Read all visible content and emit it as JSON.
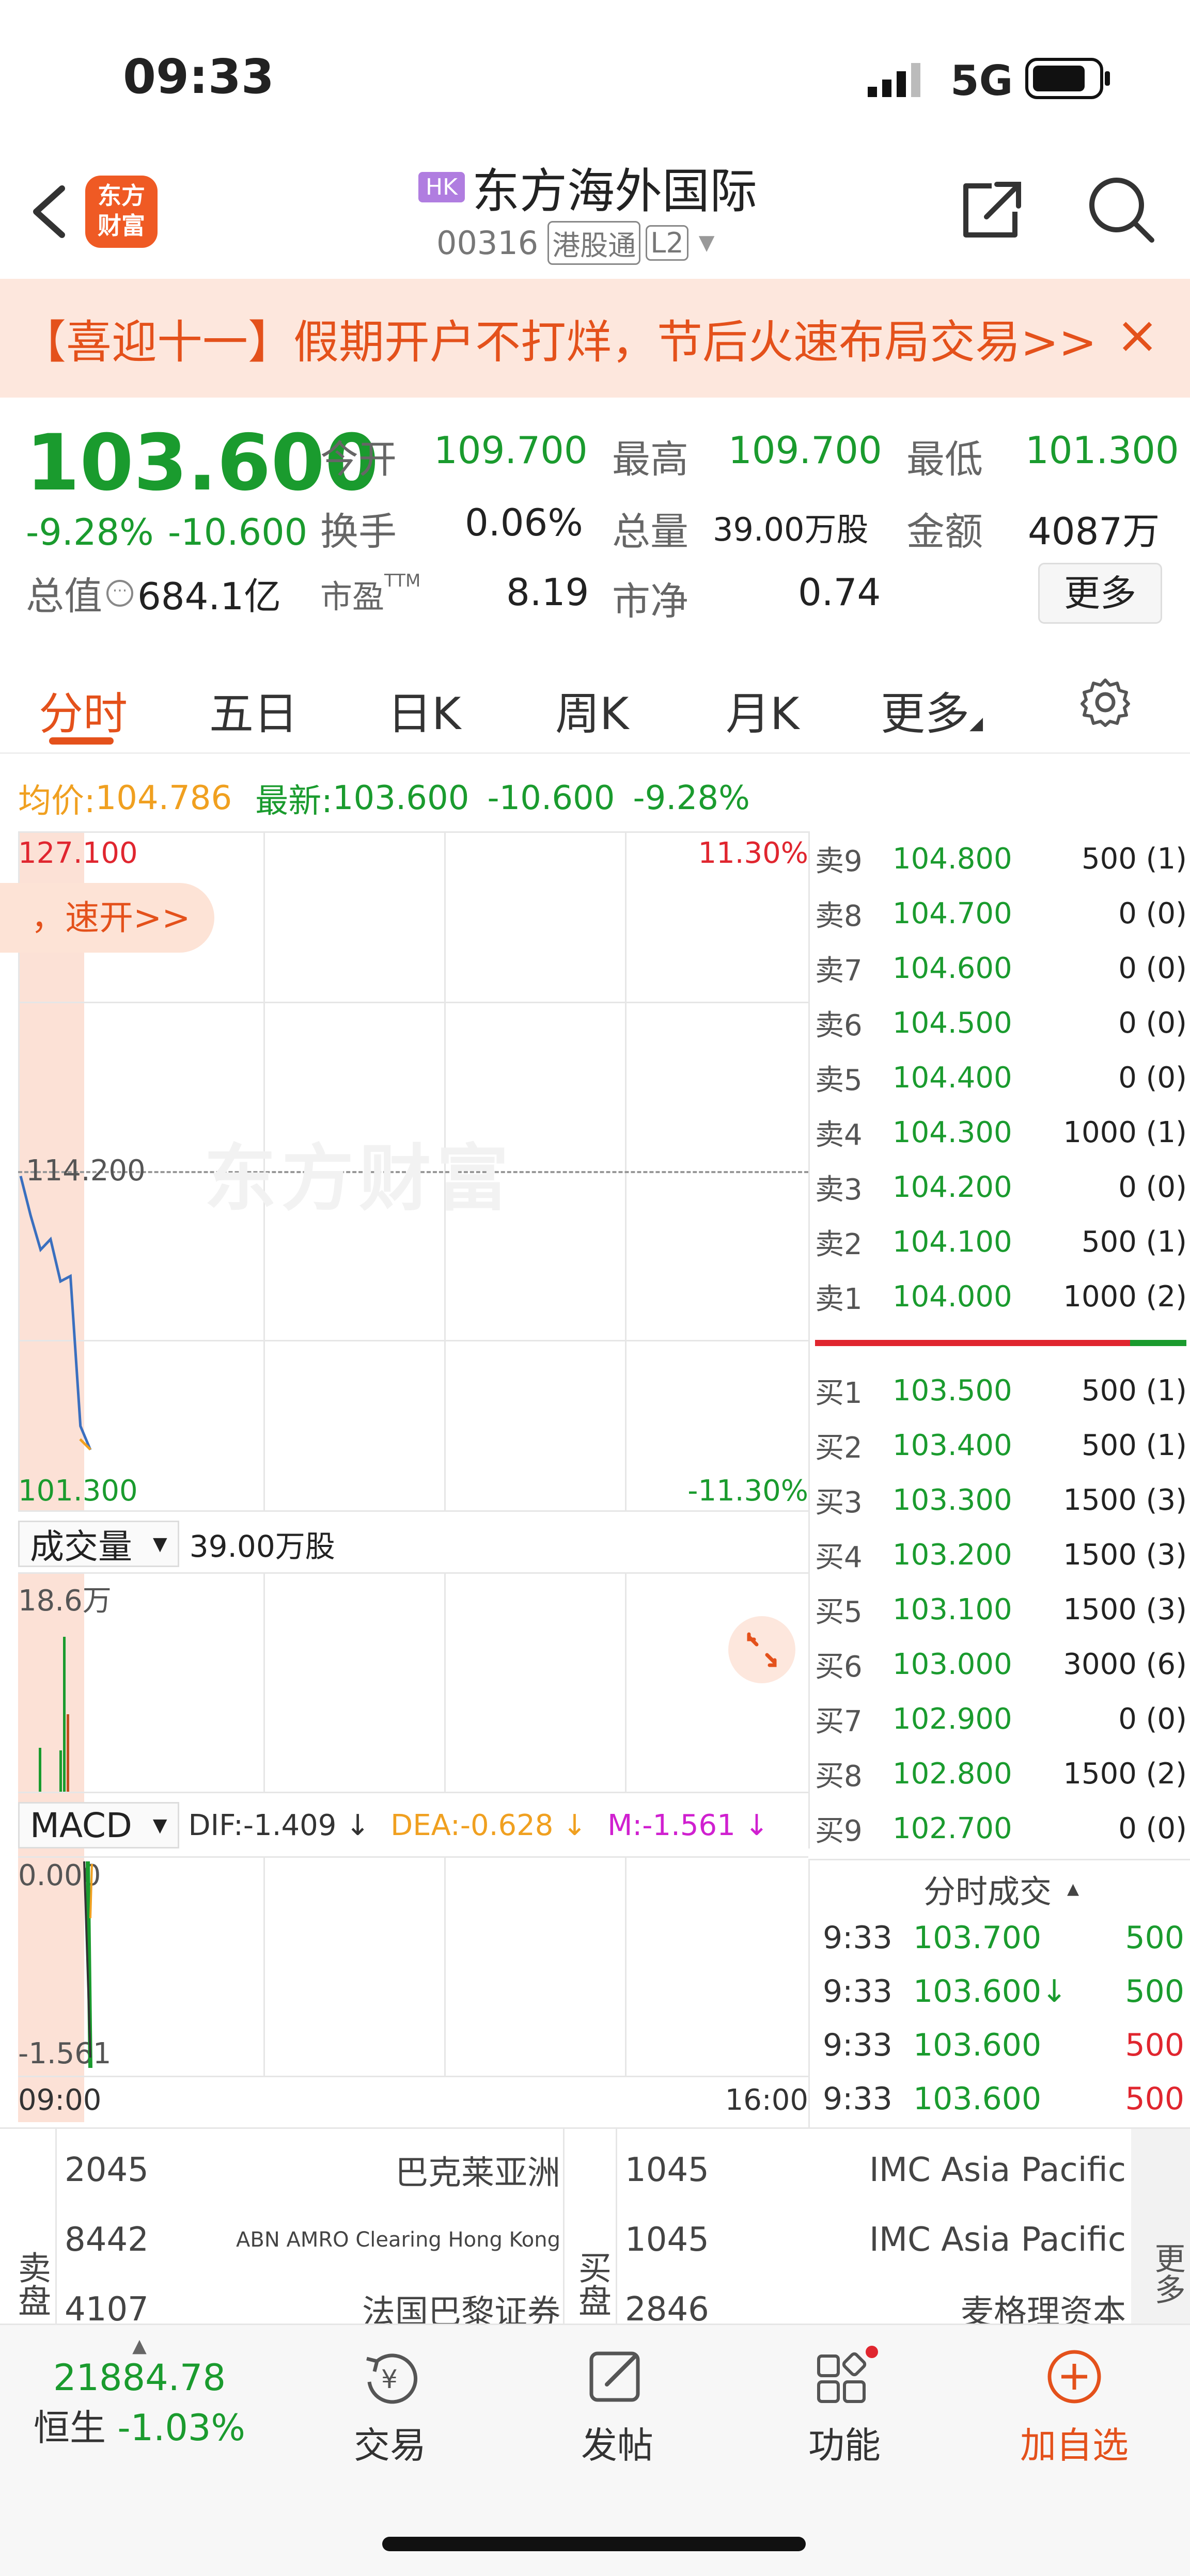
{
  "status_bar": {
    "time": "09:33",
    "network": "5G"
  },
  "header": {
    "logo_line1": "东方",
    "logo_line2": "财富",
    "market_badge": "HK",
    "stock_name": "东方海外国际",
    "stock_code": "00316",
    "tag1": "港股通",
    "tag2": "L2"
  },
  "banner": {
    "text": "【喜迎十一】假期开户不打烊，节后火速布局交易>>"
  },
  "quote": {
    "price": "103.600",
    "change_pct": "-9.28%",
    "change": "-10.600",
    "open_label": "今开",
    "open": "109.700",
    "high_label": "最高",
    "high": "109.700",
    "low_label": "最低",
    "low": "101.300",
    "turnover_label": "换手",
    "turnover": "0.06%",
    "volume_label": "总量",
    "volume": "39.00万股",
    "amount_label": "金额",
    "amount": "4087万",
    "mcap_label": "总值",
    "mcap": "684.1亿",
    "pe_label": "市盈",
    "pe_sup": "TTM",
    "pe": "8.19",
    "pb_label": "市净",
    "pb": "0.74",
    "more_label": "更多"
  },
  "tabs": [
    "分时",
    "五日",
    "日K",
    "周K",
    "月K",
    "更多"
  ],
  "chart_info": {
    "avg_label": "均价:",
    "avg": "104.786",
    "latest_label": "最新:",
    "latest": "103.600",
    "latest_change": "-10.600",
    "latest_pct": "-9.28%"
  },
  "chart_labels": {
    "y_top": "127.100",
    "y_mid": "114.200",
    "y_bottom": "101.300",
    "pct_top": "11.30%",
    "pct_bottom": "-11.30%",
    "overlay_text": "，速开>>",
    "watermark": "东方财富",
    "vol_selector": "成交量",
    "vol_total": "39.00万股",
    "vol_max": "18.6万",
    "macd_selector": "MACD",
    "dif": "DIF:-1.409 ↓",
    "dea": "DEA:-0.628 ↓",
    "m": "M:-1.561 ↓",
    "macd_top": "0.000",
    "macd_bottom": "-1.561",
    "time_start": "09:00",
    "time_end": "16:00"
  },
  "chart_data": {
    "type": "line",
    "x": [
      "09:00",
      "09:33"
    ],
    "price_range": [
      101.3,
      127.1
    ],
    "prev_close": 114.2,
    "series": [
      {
        "values": [
          114.0,
          112.5,
          111.2,
          111.6,
          110.0,
          110.2,
          104.5,
          103.6
        ]
      }
    ]
  },
  "order_book": {
    "asks": [
      {
        "label": "卖9",
        "price": "104.800",
        "vol": "500 (1)"
      },
      {
        "label": "卖8",
        "price": "104.700",
        "vol": "0 (0)"
      },
      {
        "label": "卖7",
        "price": "104.600",
        "vol": "0 (0)"
      },
      {
        "label": "卖6",
        "price": "104.500",
        "vol": "0 (0)"
      },
      {
        "label": "卖5",
        "price": "104.400",
        "vol": "0 (0)"
      },
      {
        "label": "卖4",
        "price": "104.300",
        "vol": "1000 (1)"
      },
      {
        "label": "卖3",
        "price": "104.200",
        "vol": "0 (0)"
      },
      {
        "label": "卖2",
        "price": "104.100",
        "vol": "500 (1)"
      },
      {
        "label": "卖1",
        "price": "104.000",
        "vol": "1000 (2)"
      }
    ],
    "bids": [
      {
        "label": "买1",
        "price": "103.500",
        "vol": "500 (1)"
      },
      {
        "label": "买2",
        "price": "103.400",
        "vol": "500 (1)"
      },
      {
        "label": "买3",
        "price": "103.300",
        "vol": "1500 (3)"
      },
      {
        "label": "买4",
        "price": "103.200",
        "vol": "1500 (3)"
      },
      {
        "label": "买5",
        "price": "103.100",
        "vol": "1500 (3)"
      },
      {
        "label": "买6",
        "price": "103.000",
        "vol": "3000 (6)"
      },
      {
        "label": "买7",
        "price": "102.900",
        "vol": "0 (0)"
      },
      {
        "label": "买8",
        "price": "102.800",
        "vol": "1500 (2)"
      },
      {
        "label": "买9",
        "price": "102.700",
        "vol": "0 (0)"
      }
    ]
  },
  "trades": {
    "title": "分时成交",
    "rows": [
      {
        "time": "9:33",
        "price": "103.700",
        "vol": "500"
      },
      {
        "time": "9:33",
        "price": "103.600↓",
        "vol": "500"
      },
      {
        "time": "9:33",
        "price": "103.600",
        "vol": "500"
      },
      {
        "time": "9:33",
        "price": "103.600",
        "vol": "500"
      }
    ]
  },
  "brokers": {
    "sell_label": "卖盘",
    "buy_label": "买盘",
    "more_label": "更多",
    "sell": [
      {
        "id": "2045",
        "name": "巴克莱亚洲"
      },
      {
        "id": "8442",
        "name": "ABN AMRO Clearing Hong Kong"
      },
      {
        "id": "4107",
        "name": "法国巴黎证券"
      }
    ],
    "buy": [
      {
        "id": "1045",
        "name": "IMC Asia Pacific"
      },
      {
        "id": "1045",
        "name": "IMC Asia Pacific"
      },
      {
        "id": "2846",
        "name": "麦格理资本"
      }
    ]
  },
  "bottom_nav": {
    "index_value": "21884.78",
    "index_name": "恒生",
    "index_change": "-1.03%",
    "trade": "交易",
    "post": "发帖",
    "functions": "功能",
    "add_watch": "加自选"
  },
  "colors": {
    "up": "#e0262f",
    "down": "#1a9b2e",
    "accent": "#e4511b",
    "avg_line": "#f0a020",
    "price_line": "#3a6fbf"
  }
}
